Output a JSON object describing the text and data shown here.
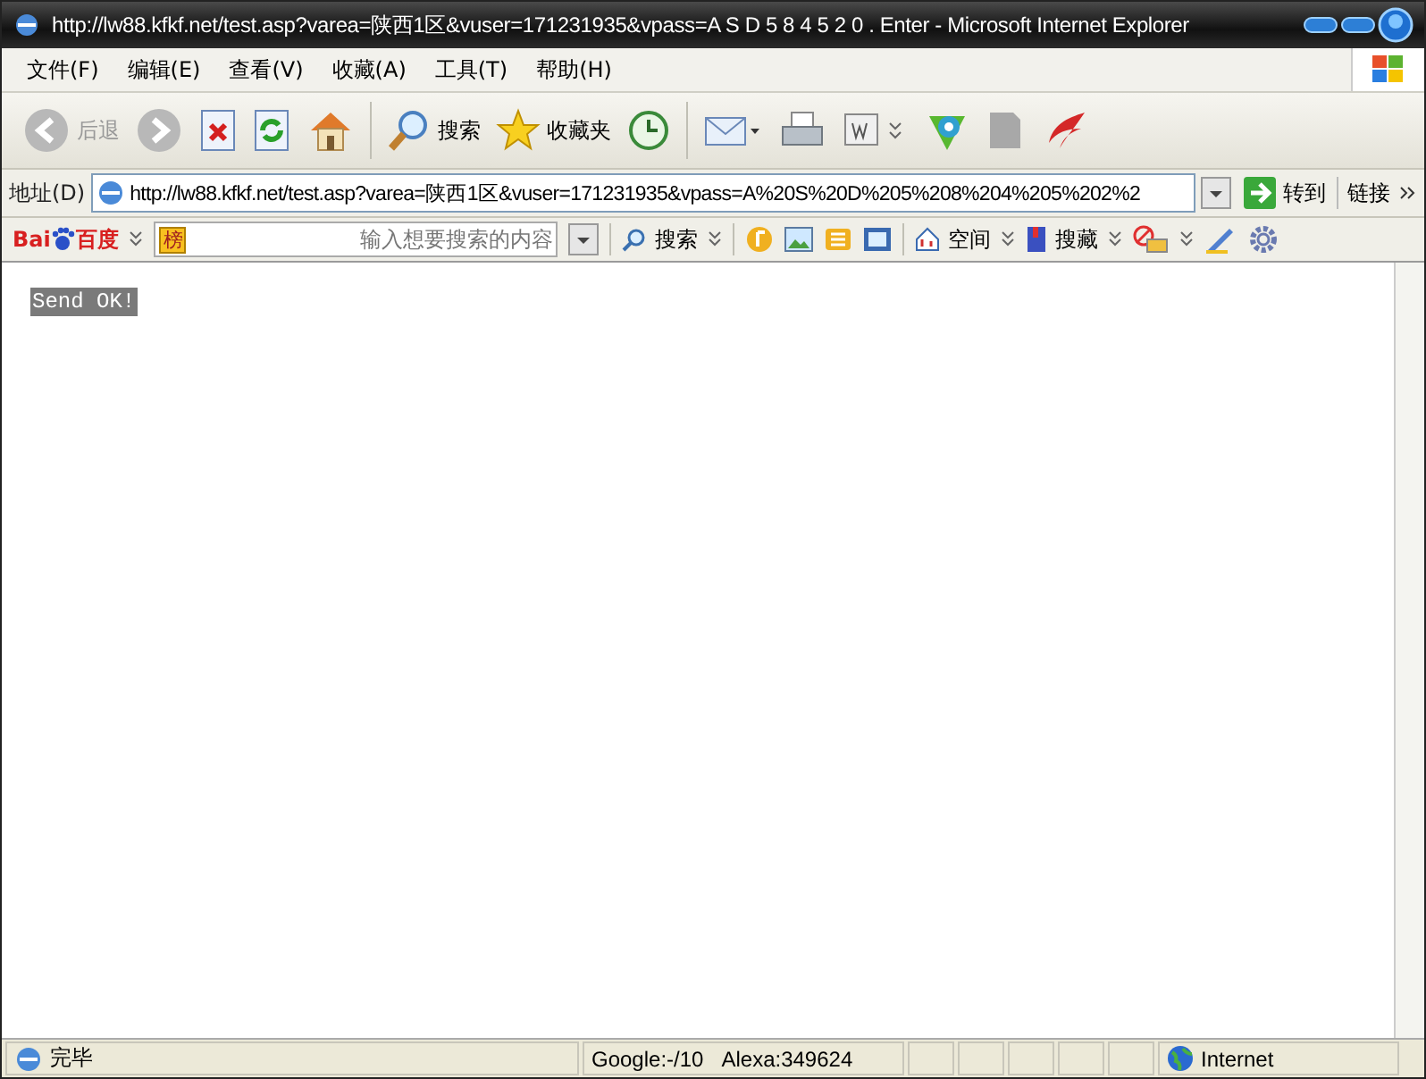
{
  "window": {
    "title": "http://lw88.kfkf.net/test.asp?varea=陕西1区&vuser=171231935&vpass=A S D 5 8 4 5 2 0 . Enter - Microsoft Internet Explorer"
  },
  "menu": [
    "文件(F)",
    "编辑(E)",
    "查看(V)",
    "收藏(A)",
    "工具(T)",
    "帮助(H)"
  ],
  "toolbar": [
    {
      "kind": "back",
      "label": "后退",
      "disabled": true
    },
    {
      "kind": "forward",
      "disabled": true
    },
    {
      "kind": "stop"
    },
    {
      "kind": "refresh"
    },
    {
      "kind": "home"
    },
    {
      "kind": "search",
      "label": "搜索"
    },
    {
      "kind": "favorites",
      "label": "收藏夹"
    },
    {
      "kind": "history"
    },
    {
      "kind": "mail"
    },
    {
      "kind": "print"
    },
    {
      "kind": "word"
    },
    {
      "kind": "messenger"
    },
    {
      "kind": "blank"
    },
    {
      "kind": "bird"
    }
  ],
  "address": {
    "label": "地址(D)",
    "value": "http://lw88.kfkf.net/test.asp?varea=陕西1区&vuser=171231935&vpass=A%20S%20D%205%208%204%205%202%2",
    "go": "转到",
    "links": "链接"
  },
  "baidu": {
    "logo_left": "Bai",
    "logo_right": "百度",
    "rank": "榜",
    "placeholder": "输入想要搜索的内容",
    "search": "搜索",
    "space": "空间",
    "collect": "搜藏"
  },
  "content": {
    "text": "Send OK!"
  },
  "status": {
    "text": "完毕",
    "google": "Google:-/10",
    "alexa": "Alexa:349624",
    "zone": "Internet"
  }
}
